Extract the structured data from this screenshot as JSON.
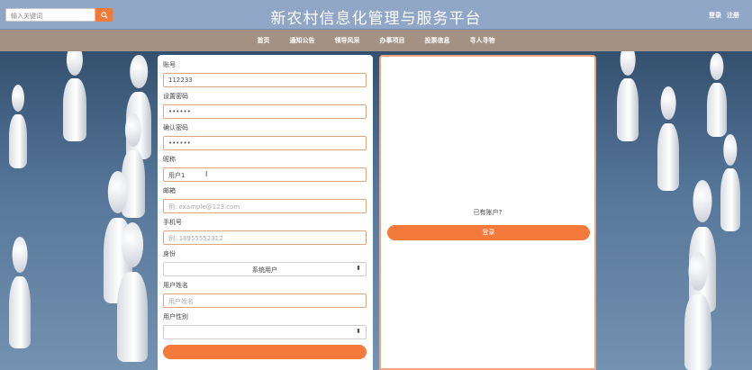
{
  "header": {
    "search_placeholder": "输入关键词",
    "search_icon": "search-icon",
    "title": "新农村信息化管理与服务平台",
    "login_link": "登录",
    "register_link": "注册"
  },
  "nav": {
    "items": [
      "首页",
      "通知公告",
      "领导风采",
      "办事项目",
      "投票信息",
      "寻人寻物"
    ]
  },
  "form": {
    "account_label": "账号",
    "account_value": "112233",
    "password_label": "设置密码",
    "password_value": "••••••",
    "confirm_label": "确认密码",
    "confirm_value": "••••••",
    "nickname_label": "昵称",
    "nickname_value": "用户1",
    "email_label": "邮箱",
    "email_placeholder": "例: example@123.com",
    "phone_label": "手机号",
    "phone_placeholder": "例: 18955552312",
    "identity_label": "身份",
    "identity_value": "系统用户",
    "username_label": "用户姓名",
    "username_placeholder": "用户姓名",
    "gender_label": "用户性别",
    "gender_value": ""
  },
  "side": {
    "has_account_text": "已有账户?",
    "login_button": "登录"
  },
  "colors": {
    "header_bg": "#8fa6c6",
    "nav_bg": "#a39283",
    "accent": "#f47a3c"
  }
}
